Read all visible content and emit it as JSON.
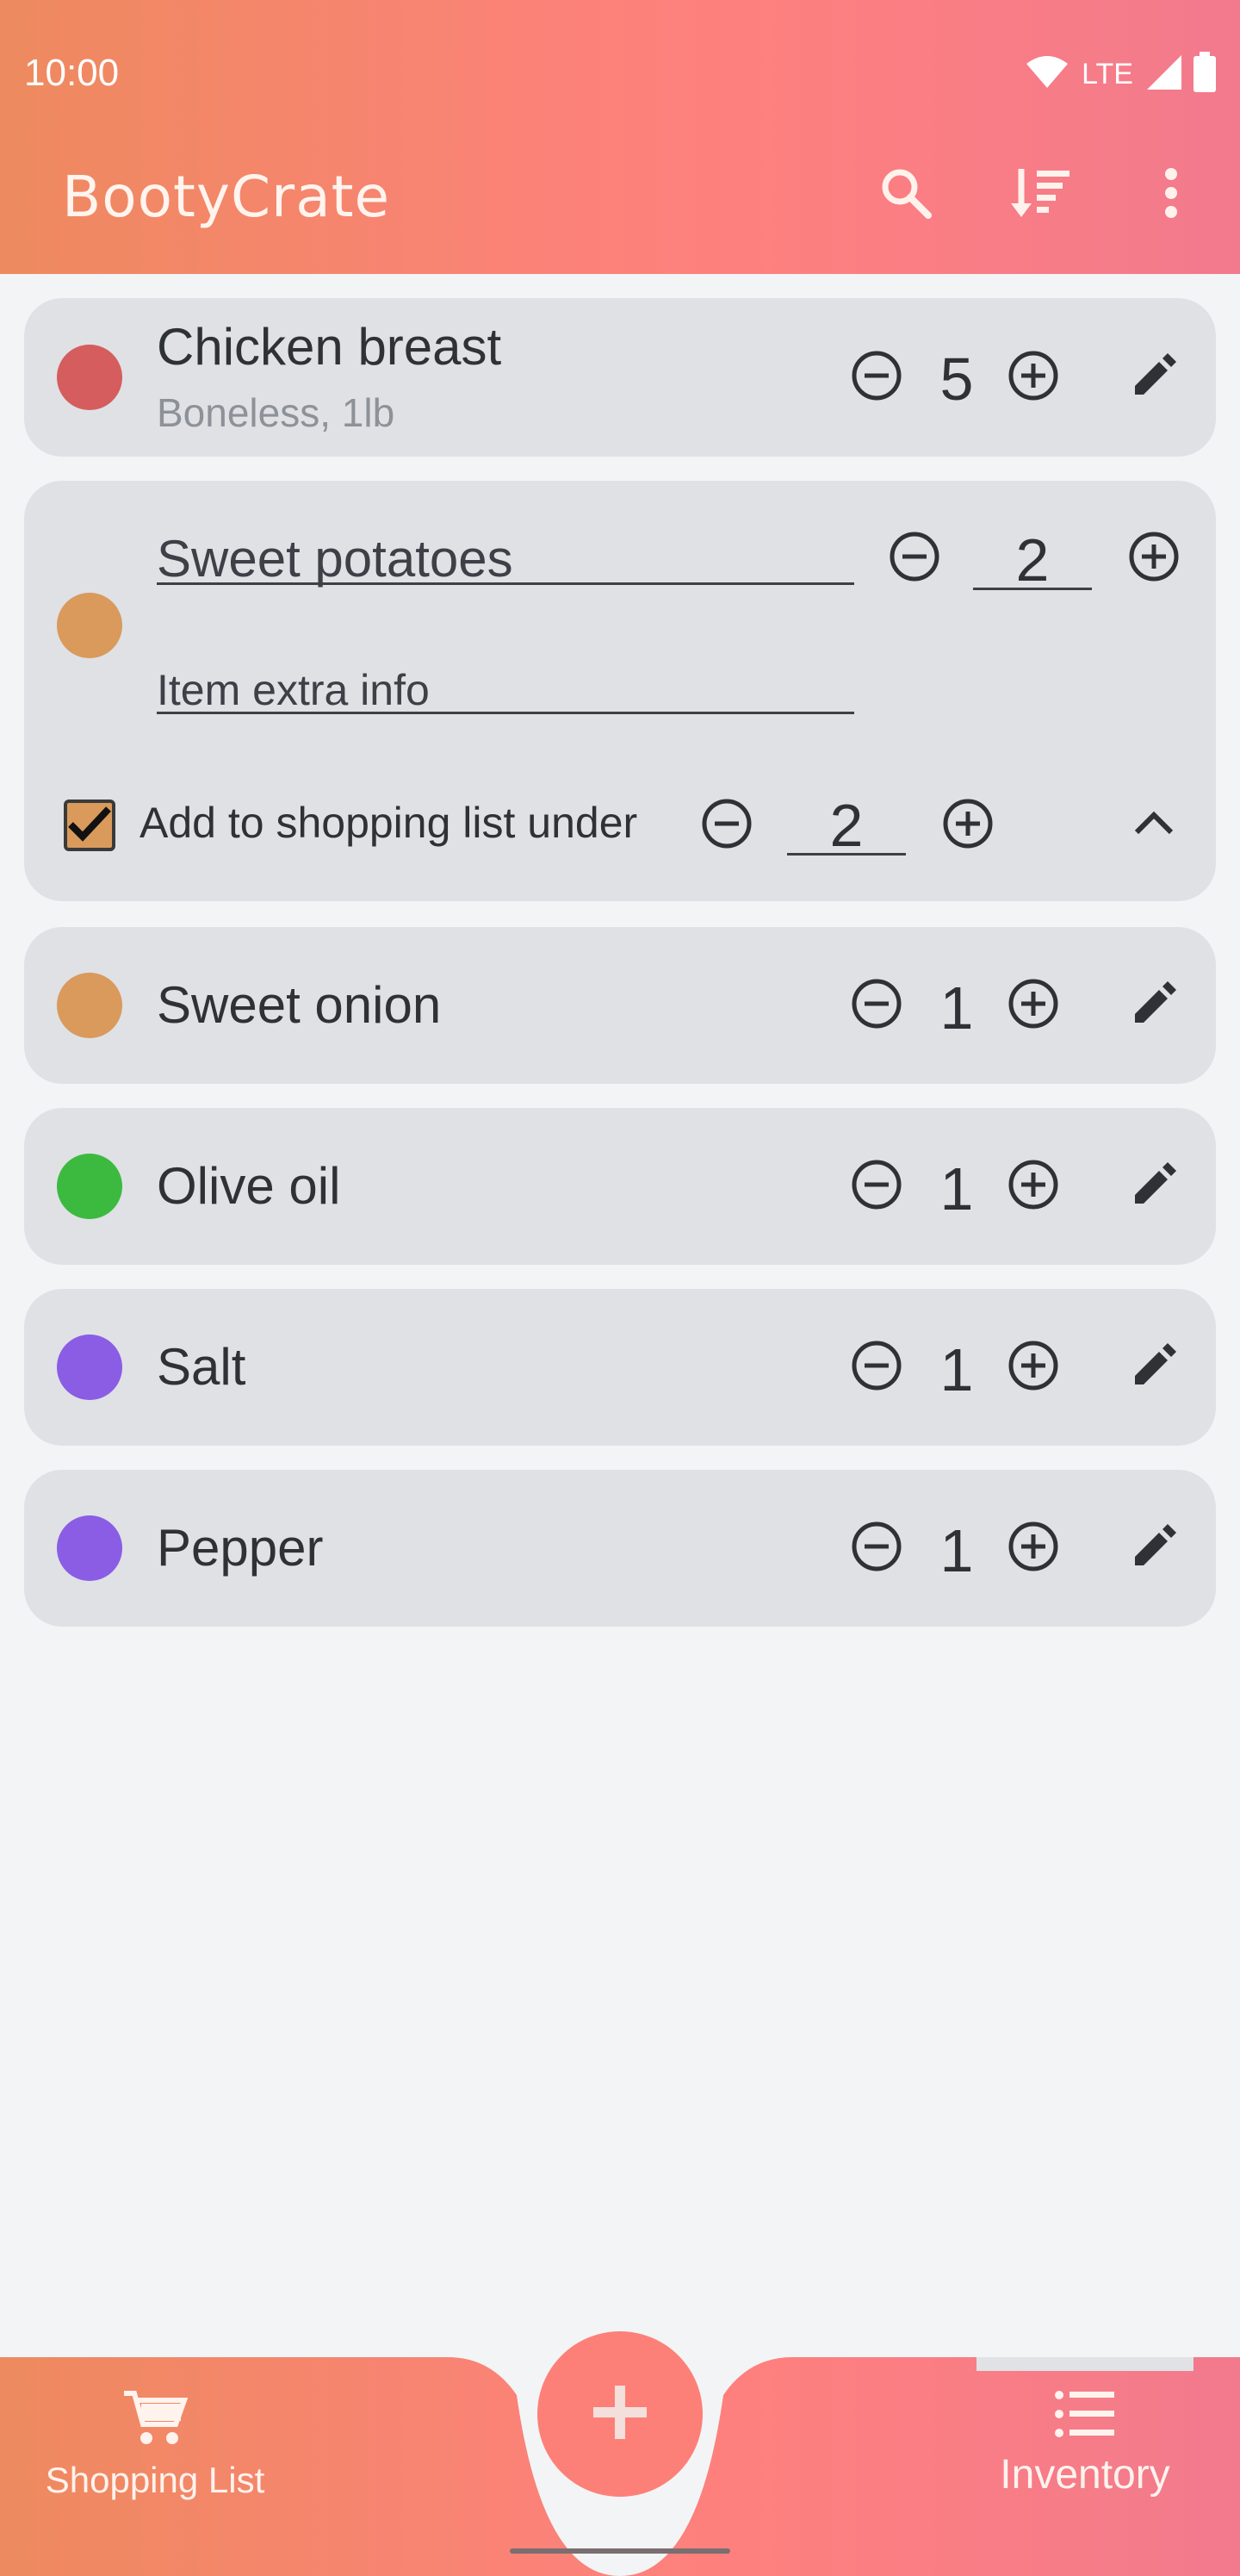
{
  "status_bar": {
    "time": "10:00",
    "network": "LTE",
    "icons": [
      "wifi-icon",
      "cell-signal-icon",
      "battery-icon"
    ]
  },
  "app_bar": {
    "title": "BootyCrate",
    "actions": [
      "search-icon",
      "sort-icon",
      "more-vert-icon"
    ]
  },
  "colors": {
    "accent_start": "#ee8a5f",
    "accent_mid": "#fe807e",
    "accent_end": "#f27a8d",
    "card_bg": "#dfe1e5",
    "page_bg": "#f3f4f6"
  },
  "items": [
    {
      "name": "Chicken breast",
      "extra_info": "Boneless, 1lb",
      "quantity": "5",
      "color": "#d55d5d"
    },
    {
      "name": "Sweet potatoes",
      "extra_info_placeholder": "Item extra info",
      "quantity": "2",
      "color": "#d99a5b",
      "expanded": true,
      "shopping_list_label": "Add to shopping list under",
      "shopping_list_checked": true,
      "shopping_quantity": "2"
    },
    {
      "name": "Sweet onion",
      "quantity": "1",
      "color": "#d99a5b"
    },
    {
      "name": "Olive oil",
      "quantity": "1",
      "color": "#3cba3f"
    },
    {
      "name": "Salt",
      "quantity": "1",
      "color": "#8a5de4"
    },
    {
      "name": "Pepper",
      "quantity": "1",
      "color": "#8a5de4"
    }
  ],
  "bottom_nav": {
    "shopping_list_label": "Shopping List",
    "inventory_label": "Inventory",
    "selected": "Inventory",
    "fab_icon": "add-icon"
  }
}
